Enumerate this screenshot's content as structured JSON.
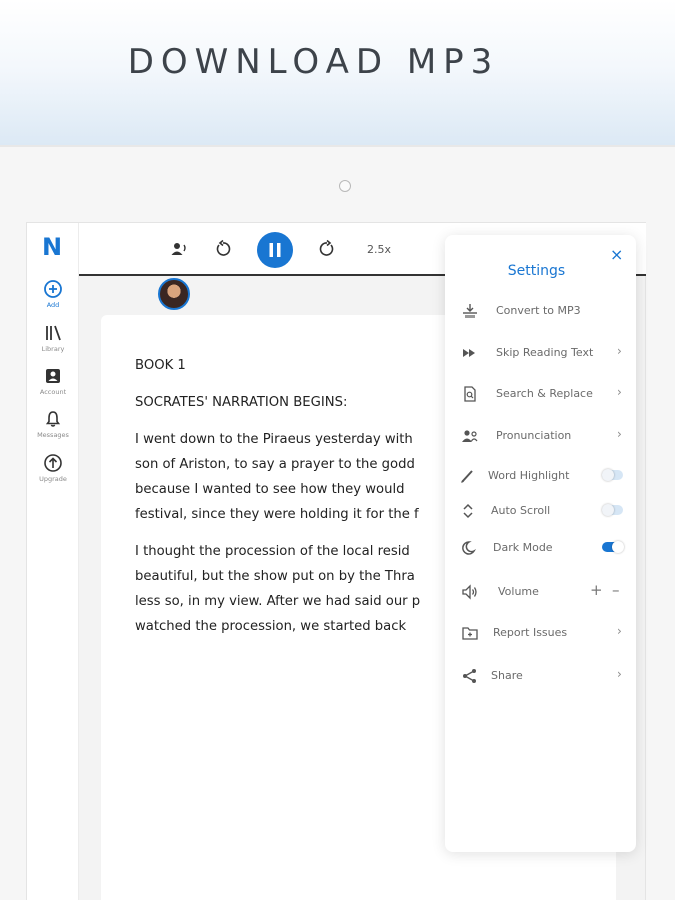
{
  "banner": {
    "title": "DOWNLOAD MP3"
  },
  "app": {
    "logo": "N",
    "nav": [
      {
        "label": "Add",
        "icon": "plus-circle-icon"
      },
      {
        "label": "Library",
        "icon": "library-icon"
      },
      {
        "label": "Account",
        "icon": "account-icon"
      },
      {
        "label": "Messages",
        "icon": "bell-icon"
      },
      {
        "label": "Upgrade",
        "icon": "upgrade-arrow-icon"
      }
    ],
    "player": {
      "speed": "2.5x",
      "state": "playing"
    },
    "accent_color": "#1976d2"
  },
  "reader": {
    "lines": [
      "BOOK 1",
      "SOCRATES' NARRATION BEGINS:",
      "I went down to the Piraeus yesterday with",
      "son of Ariston, to say a prayer to the godd",
      "because I wanted to see how they would",
      "festival, since they were holding it for the f",
      "I thought the procession of the local resid",
      "beautiful, but the show put on by the Thra",
      "less so, in my view. After we had said our p",
      "watched the procession, we started back"
    ]
  },
  "settings": {
    "title": "Settings",
    "items": [
      {
        "label": "Convert to MP3",
        "icon": "mp3-download-icon"
      },
      {
        "label": "Skip Reading Text",
        "icon": "skip-forward-icon"
      },
      {
        "label": "Search & Replace",
        "icon": "search-document-icon"
      },
      {
        "label": "Pronunciation",
        "icon": "pronunciation-icon"
      },
      {
        "label": "Word Highlight",
        "icon": "pencil-icon",
        "toggle": false
      },
      {
        "label": "Auto Scroll",
        "icon": "scroll-arrows-icon",
        "toggle": false
      },
      {
        "label": "Dark Mode",
        "icon": "moon-icon",
        "toggle": true
      },
      {
        "label": "Volume",
        "icon": "speaker-icon"
      },
      {
        "label": "Report Issues",
        "icon": "report-icon"
      },
      {
        "label": "Share",
        "icon": "share-icon"
      }
    ],
    "volume_plus": "+",
    "volume_minus": "–",
    "close": "×",
    "chevron": "›"
  }
}
